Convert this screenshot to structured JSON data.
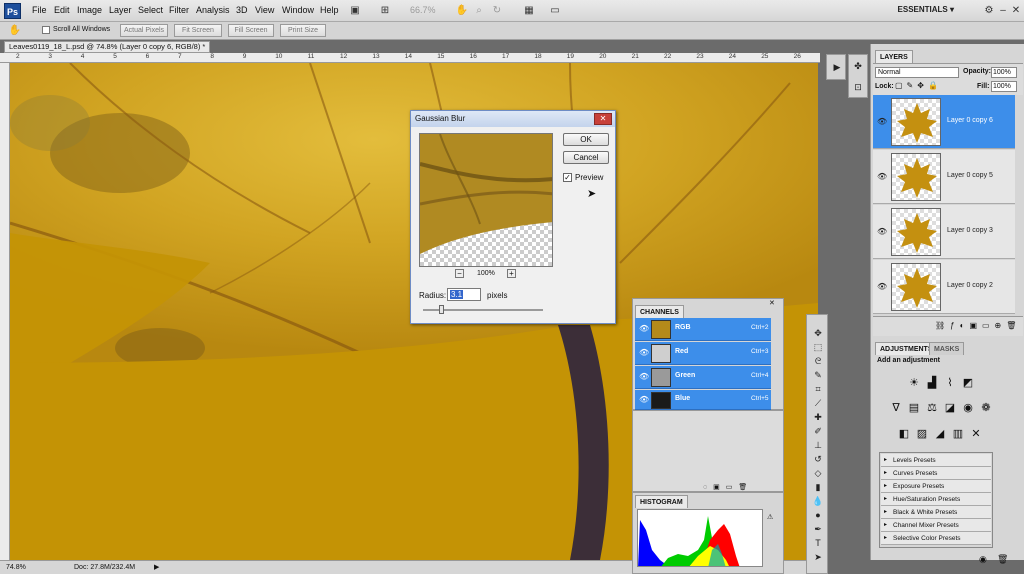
{
  "menubar": {
    "logo": "Ps",
    "items": [
      "File",
      "Edit",
      "Image",
      "Layer",
      "Select",
      "Filter",
      "Analysis",
      "3D",
      "View",
      "Window",
      "Help"
    ],
    "zoom": "66.7%",
    "workspace": "ESSENTIALS ▾"
  },
  "options": {
    "scroll_all": "Scroll All Windows",
    "buttons": [
      "Actual Pixels",
      "Fit Screen",
      "Fill Screen",
      "Print Size"
    ]
  },
  "document": {
    "tab_title": "Leaves0119_18_L.psd @ 74.8% (Layer 0 copy 6, RGB/8) *",
    "ruler_ticks": [
      "2",
      "3",
      "4",
      "5",
      "6",
      "7",
      "8",
      "9",
      "10",
      "11",
      "12",
      "13",
      "14",
      "15",
      "16",
      "17",
      "18",
      "19",
      "20",
      "21",
      "22",
      "23",
      "24",
      "25",
      "26"
    ],
    "status_zoom": "74.8%",
    "status_doc": "Doc: 27.8M/232.4M",
    "colors": {
      "leaf": "#c49305",
      "leaf_light": "#dcb535",
      "vein": "#8a5a10",
      "dark_ring": "#3c2e38"
    }
  },
  "gaussian_blur": {
    "title": "Gaussian Blur",
    "ok": "OK",
    "cancel": "Cancel",
    "preview_label": "Preview",
    "preview_checked": true,
    "zoom_out": "−",
    "zoom": "100%",
    "zoom_in": "+",
    "radius_label": "Radius:",
    "radius_value": "3.1",
    "units": "pixels",
    "slider_fraction": 0.15
  },
  "layers": {
    "tab": "LAYERS",
    "blend_mode": "Normal",
    "opacity_label": "Opacity:",
    "opacity": "100%",
    "lock_label": "Lock:",
    "fill_label": "Fill:",
    "fill": "100%",
    "items": [
      {
        "name": "Layer 0 copy 6",
        "selected": true
      },
      {
        "name": "Layer 0 copy 5",
        "selected": false
      },
      {
        "name": "Layer 0 copy 3",
        "selected": false
      },
      {
        "name": "Layer 0 copy 2",
        "selected": false
      }
    ]
  },
  "adjustments": {
    "tabs": [
      "ADJUSTMENTS",
      "MASKS"
    ],
    "heading": "Add an adjustment",
    "presets": [
      "Levels Presets",
      "Curves Presets",
      "Exposure Presets",
      "Hue/Saturation Presets",
      "Black & White Presets",
      "Channel Mixer Presets",
      "Selective Color Presets"
    ]
  },
  "channels": {
    "tab": "CHANNELS",
    "items": [
      {
        "name": "RGB",
        "shortcut": "Ctrl+2",
        "thumb": "#b48a1a"
      },
      {
        "name": "Red",
        "shortcut": "Ctrl+3",
        "thumb": "#cfcfcf"
      },
      {
        "name": "Green",
        "shortcut": "Ctrl+4",
        "thumb": "#9a9a9a"
      },
      {
        "name": "Blue",
        "shortcut": "Ctrl+5",
        "thumb": "#1a1a1a"
      }
    ]
  },
  "histogram": {
    "tab": "HISTOGRAM"
  }
}
